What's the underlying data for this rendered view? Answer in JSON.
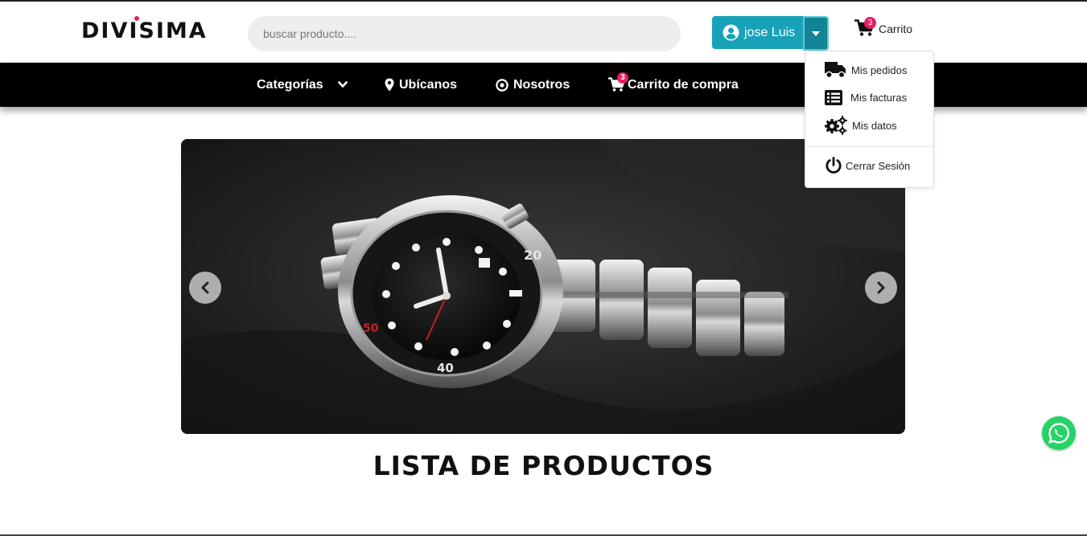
{
  "brand": {
    "logo_text": "DIVISIMA",
    "accent_color": "#e91e63"
  },
  "header": {
    "search": {
      "placeholder": "buscar producto....",
      "value": ""
    },
    "user": {
      "name": "jose Luis",
      "icon": "user-circle-icon",
      "button_color": "#17a2b8"
    },
    "cart": {
      "label": "Carrito",
      "count": "3",
      "icon": "cart-icon"
    }
  },
  "nav": {
    "items": [
      {
        "label": "Categorías",
        "icon": "chevron-down-icon"
      },
      {
        "label": "Ubícanos",
        "icon": "map-marker-icon"
      },
      {
        "label": "Nosotros",
        "icon": "target-icon"
      },
      {
        "label": "Carrito de compra",
        "icon": "cart-icon",
        "badge": "3"
      }
    ]
  },
  "user_menu": {
    "items": [
      {
        "label": "Mis pedidos",
        "icon": "truck-icon"
      },
      {
        "label": "Mis facturas",
        "icon": "list-icon"
      },
      {
        "label": "Mis datos",
        "icon": "gears-icon"
      },
      {
        "label": "Cerrar Sesión",
        "icon": "power-icon"
      }
    ]
  },
  "carousel": {
    "slide_image": "wristwatch-photo",
    "prev_icon": "chevron-left-icon",
    "next_icon": "chevron-right-icon"
  },
  "main": {
    "section_title": "LISTA DE PRODUCTOS"
  },
  "floating": {
    "whatsapp_icon": "whatsapp-icon",
    "color": "#25d366"
  }
}
